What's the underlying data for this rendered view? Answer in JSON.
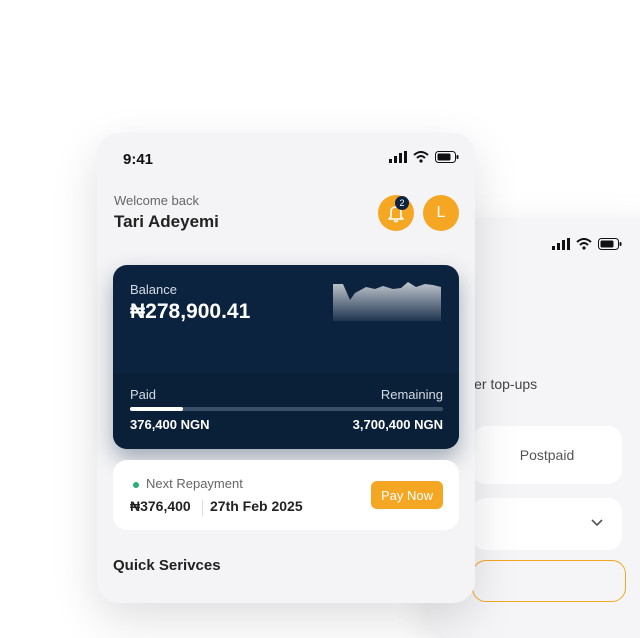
{
  "status": {
    "time": "9:41"
  },
  "header": {
    "welcome": "Welcome back",
    "user_name": "Tari Adeyemi",
    "notification_count": "2",
    "avatar_initial": "L"
  },
  "balance": {
    "label": "Balance",
    "value": "₦278,900.41",
    "paid_label": "Paid",
    "remaining_label": "Remaining",
    "paid_value": "376,400 NGN",
    "remaining_value": "3,700,400 NGN",
    "paid_fraction": 0.17
  },
  "repayment": {
    "label": "Next Repayment",
    "amount": "₦376,400",
    "date": "27th Feb 2025",
    "button": "Pay Now"
  },
  "sections": {
    "quick_services": "Quick Serivces"
  },
  "back_screen": {
    "text": "wer top-ups",
    "tab": "Postpaid"
  },
  "colors": {
    "accent": "#f5a623",
    "card": "#0c2340",
    "dot": "#27b074"
  }
}
